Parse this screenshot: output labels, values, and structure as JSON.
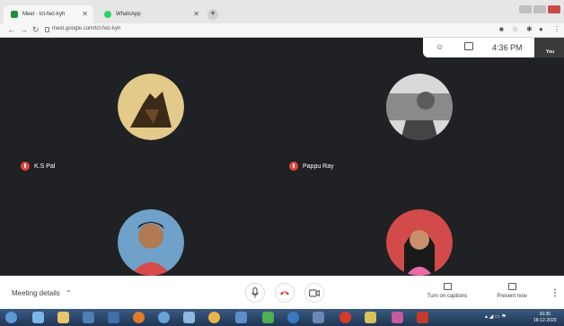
{
  "browser": {
    "tabs": [
      {
        "title": "Meet - tct-fwz-kyh",
        "favicon": "meet-icon",
        "color": "#1e8e3e"
      },
      {
        "title": "WhatsApp",
        "favicon": "whatsapp-icon",
        "color": "#25d366"
      }
    ],
    "url": "meet.google.com/tct-fwz-kyh"
  },
  "meet": {
    "time": "4:36 PM",
    "self_label": "You",
    "participants": [
      {
        "name": "K.S Pal",
        "muted": true
      },
      {
        "name": "Pappu Ray",
        "muted": true
      }
    ],
    "bottom_bar": {
      "details_label": "Meeting details",
      "captions_label": "Turn on captions",
      "present_label": "Present now"
    }
  },
  "taskbar": {
    "clock_time": "16:36",
    "clock_date": "18-12-2020"
  }
}
